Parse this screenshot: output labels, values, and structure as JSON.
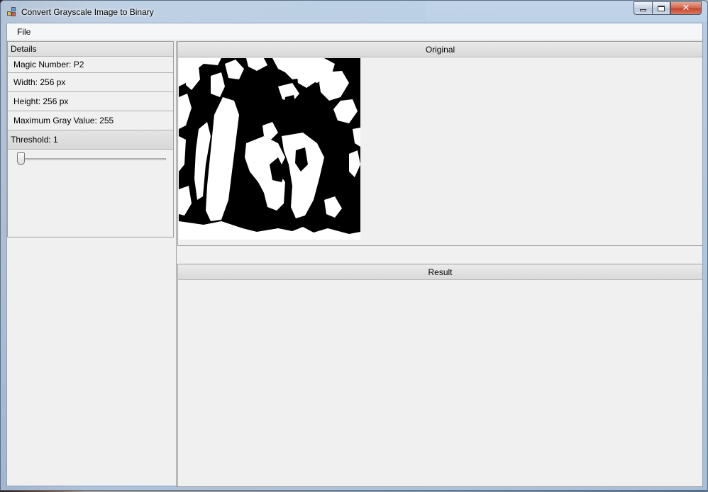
{
  "window": {
    "title": "Convert Grayscale Image to Binary",
    "close_glyph": "✕"
  },
  "menu": {
    "items": [
      {
        "label": "File"
      }
    ]
  },
  "details": {
    "header": "Details",
    "magic_number": "Magic Number: P2",
    "width": "Width: 256 px",
    "height": "Height: 256 px",
    "max_gray": "Maximum Gray Value: 255",
    "threshold_label": "Threshold: 1",
    "threshold_value": 1,
    "threshold_min": 0,
    "threshold_max": 255
  },
  "panels": {
    "original": {
      "title": "Original"
    },
    "result": {
      "title": "Result"
    }
  },
  "icons": {
    "app": "app-icon",
    "minimize": "minimize-icon",
    "maximize": "maximize-icon",
    "close": "close-icon"
  },
  "colors": {
    "accent_close": "#c6432a",
    "panel_bg": "#f0f0f0"
  }
}
